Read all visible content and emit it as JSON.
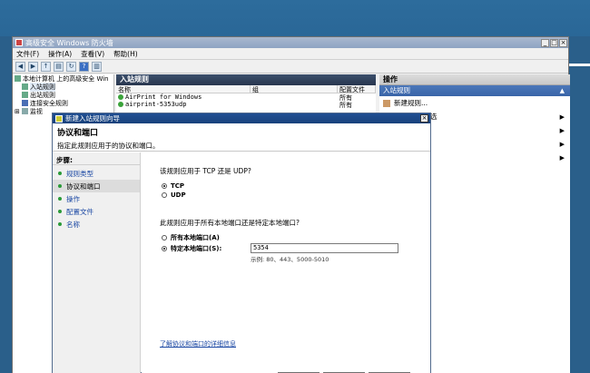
{
  "window": {
    "title": "高级安全 Windows 防火墙"
  },
  "menu": [
    "文件(F)",
    "操作(A)",
    "查看(V)",
    "帮助(H)"
  ],
  "tree": [
    {
      "label": "本地计算机 上的高级安全 Win"
    },
    {
      "label": "入站规则"
    },
    {
      "label": "出站规则"
    },
    {
      "label": "连接安全规则"
    },
    {
      "label": "监视"
    }
  ],
  "list": {
    "header": "入站规则",
    "columns": [
      "名称",
      "组",
      "配置文件"
    ],
    "rows": [
      {
        "name": "AirPrint for Windows",
        "profile": "所有"
      },
      {
        "name": "airprint-5353udp",
        "profile": "所有"
      }
    ]
  },
  "actions": {
    "header": "操作",
    "section": "入站规则",
    "items": [
      {
        "label": "新建规则..."
      },
      {
        "label": "选"
      },
      {
        "label": ""
      },
      {
        "label": ""
      },
      {
        "label": ""
      }
    ]
  },
  "wizard": {
    "title": "新建入站规则向导",
    "heading": "协议和端口",
    "subheading": "指定此规则应用于的协议和端口。",
    "steps_title": "步骤:",
    "steps": [
      "规则类型",
      "协议和端口",
      "操作",
      "配置文件",
      "名称"
    ],
    "current_step": 1,
    "q_protocol": "该规则应用于 TCP 还是 UDP?",
    "opt_tcp": "TCP",
    "opt_udp": "UDP",
    "q_ports": "此规则应用于所有本地端口还是特定本地端口?",
    "opt_all_ports": "所有本地端口(A)",
    "opt_specific_ports": "特定本地端口(S):",
    "port_value": "5354",
    "example": "示例: 80、443、5000-5010",
    "link": "了解协议和端口的详细信息"
  }
}
